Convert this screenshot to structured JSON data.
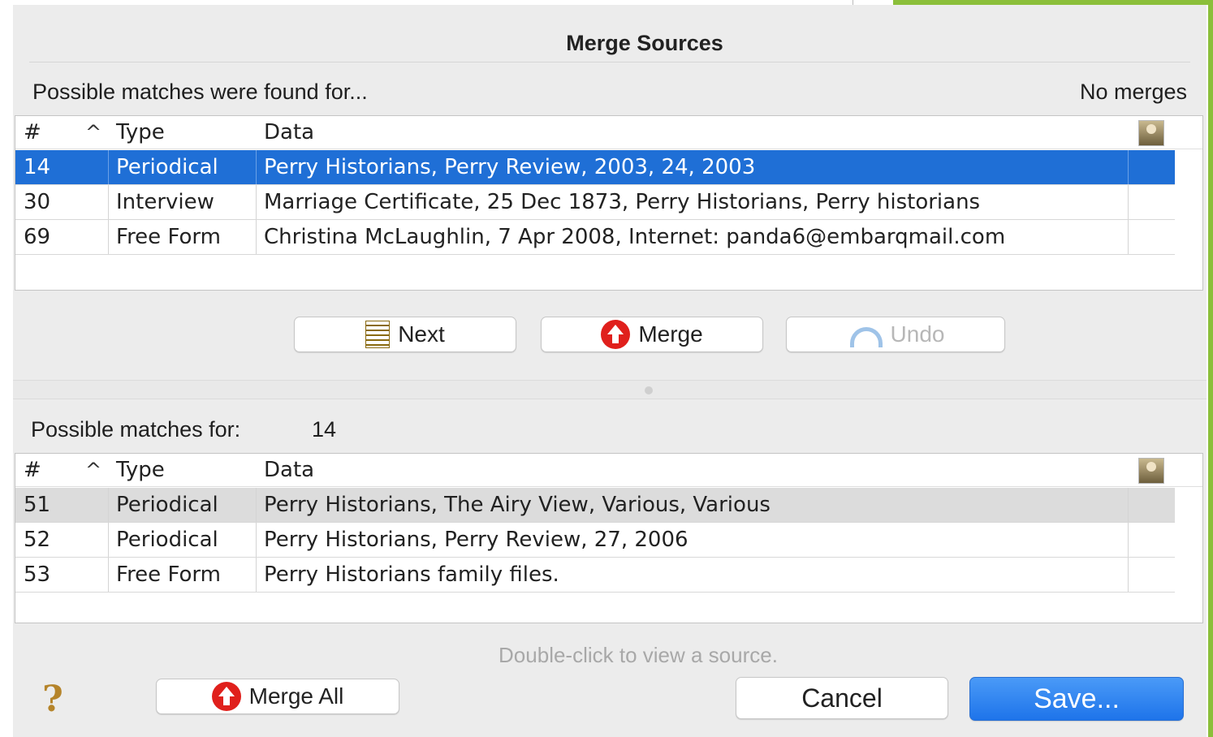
{
  "dialog": {
    "title": "Merge Sources",
    "found_label": "Possible matches were found for...",
    "merge_count": "No merges",
    "matches_for_label": "Possible matches for:",
    "matches_for_value": "14",
    "hint": "Double-click to view a source."
  },
  "columns": {
    "num": "#",
    "type": "Type",
    "data": "Data",
    "sort_indicator": "^",
    "picture_column_icon": "person-photo-icon"
  },
  "top_table": {
    "rows": [
      {
        "num": "14",
        "type": "Periodical",
        "data": "Perry Historians, Perry Review, 2003, 24, 2003",
        "selected": true
      },
      {
        "num": "30",
        "type": "Interview",
        "data": "Marriage Certificate, 25 Dec 1873, Perry Historians, Perry historians",
        "selected": false
      },
      {
        "num": "69",
        "type": "Free Form",
        "data": "Christina McLaughlin, 7 Apr 2008, Internet: panda6@embarqmail.com",
        "selected": false
      }
    ]
  },
  "bottom_table": {
    "rows": [
      {
        "num": "51",
        "type": "Periodical",
        "data": "Perry Historians, The Airy View, Various, Various",
        "highlighted": true
      },
      {
        "num": "52",
        "type": "Periodical",
        "data": "Perry Historians, Perry Review, 27, 2006",
        "highlighted": false
      },
      {
        "num": "53",
        "type": "Free Form",
        "data": "Perry Historians family files.",
        "highlighted": false
      }
    ]
  },
  "buttons": {
    "next": "Next",
    "merge": "Merge",
    "undo": "Undo",
    "merge_all": "Merge All",
    "cancel": "Cancel",
    "save": "Save..."
  },
  "icons": {
    "help": "?",
    "next": "next-list-icon",
    "merge": "merge-up-arrow-icon",
    "undo": "undo-arrow-icon"
  },
  "colors": {
    "selection": "#1f6fd6",
    "primary_button": "#1e74ea",
    "merge_icon": "#e0201c"
  }
}
